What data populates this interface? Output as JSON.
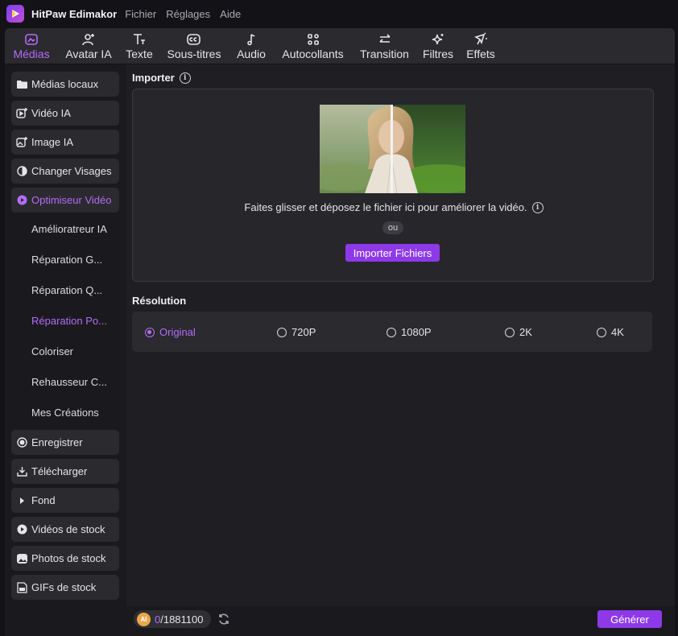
{
  "app": {
    "title": "HitPaw Edimakor"
  },
  "menu": [
    "Fichier",
    "Réglages",
    "Aide"
  ],
  "toolbar": [
    {
      "label": "Médias",
      "icon": "media-icon",
      "active": true
    },
    {
      "label": "Avatar IA",
      "icon": "avatar-icon"
    },
    {
      "label": "Texte",
      "icon": "text-icon"
    },
    {
      "label": "Sous-titres",
      "icon": "subtitles-icon"
    },
    {
      "label": "Audio",
      "icon": "music-note-icon"
    },
    {
      "label": "Autocollants",
      "icon": "stickers-icon"
    },
    {
      "label": "Transition",
      "icon": "transition-arrows-icon"
    },
    {
      "label": "Filtres",
      "icon": "sparkle-icon"
    },
    {
      "label": "Effets",
      "icon": "effects-icon"
    }
  ],
  "sidebar": {
    "items": [
      {
        "label": "Médias locaux",
        "icon": "folder-icon"
      },
      {
        "label": "Vidéo IA",
        "icon": "ai-video-icon"
      },
      {
        "label": "Image IA",
        "icon": "ai-image-icon"
      },
      {
        "label": "Changer Visages",
        "icon": "face-swap-icon"
      },
      {
        "label": "Optimiseur Vidéo",
        "icon": "video-enhancer-icon",
        "active": true
      }
    ],
    "subitems": [
      {
        "label": "Amélioratreur IA"
      },
      {
        "label": "Réparation G..."
      },
      {
        "label": "Réparation Q..."
      },
      {
        "label": "Réparation Po...",
        "active": true
      },
      {
        "label": "Coloriser"
      },
      {
        "label": "Rehausseur C..."
      },
      {
        "label": "Mes Créations"
      }
    ],
    "items2": [
      {
        "label": "Enregistrer",
        "icon": "record-icon"
      },
      {
        "label": "Télécharger",
        "icon": "download-icon"
      },
      {
        "label": "Fond",
        "icon": "caret-right-icon"
      },
      {
        "label": "Vidéos de stock",
        "icon": "play-icon"
      },
      {
        "label": "Photos de stock",
        "icon": "photo-icon"
      },
      {
        "label": "GIFs de stock",
        "icon": "gif-icon"
      }
    ]
  },
  "import": {
    "title": "Importer",
    "drop_text": "Faites glisser et déposez le fichier ici pour améliorer la vidéo.",
    "or": "ou",
    "button": "Importer Fichiers"
  },
  "resolution": {
    "title": "Résolution",
    "options": [
      {
        "label": "Original",
        "checked": true
      },
      {
        "label": "720P"
      },
      {
        "label": "1080P"
      },
      {
        "label": "2K"
      },
      {
        "label": "4K"
      }
    ]
  },
  "footer": {
    "coin": "AI",
    "credits_used": "0",
    "credits_total": "/1881100",
    "generate": "Générer"
  },
  "colors": {
    "accent": "#b56cf7",
    "button": "#8e39e8",
    "background": "#1f1f23"
  }
}
